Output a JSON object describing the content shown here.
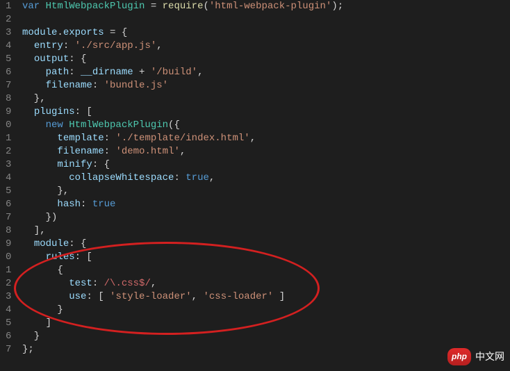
{
  "lines": [
    {
      "n": "1",
      "tokens": [
        {
          "t": "var ",
          "c": "kw"
        },
        {
          "t": "HtmlWebpackPlugin",
          "c": "cls"
        },
        {
          "t": " = ",
          "c": "punc"
        },
        {
          "t": "require",
          "c": "fn"
        },
        {
          "t": "(",
          "c": "punc"
        },
        {
          "t": "'html-webpack-plugin'",
          "c": "str"
        },
        {
          "t": ");",
          "c": "punc"
        }
      ]
    },
    {
      "n": "2",
      "tokens": []
    },
    {
      "n": "3",
      "tokens": [
        {
          "t": "module",
          "c": "var"
        },
        {
          "t": ".",
          "c": "punc"
        },
        {
          "t": "exports",
          "c": "var"
        },
        {
          "t": " = {",
          "c": "punc"
        }
      ]
    },
    {
      "n": "4",
      "tokens": [
        {
          "t": "  ",
          "c": "punc"
        },
        {
          "t": "entry",
          "c": "prop"
        },
        {
          "t": ": ",
          "c": "punc"
        },
        {
          "t": "'./src/app.js'",
          "c": "str"
        },
        {
          "t": ",",
          "c": "punc"
        }
      ]
    },
    {
      "n": "5",
      "tokens": [
        {
          "t": "  ",
          "c": "punc"
        },
        {
          "t": "output",
          "c": "prop"
        },
        {
          "t": ": {",
          "c": "punc"
        }
      ]
    },
    {
      "n": "6",
      "tokens": [
        {
          "t": "    ",
          "c": "punc"
        },
        {
          "t": "path",
          "c": "prop"
        },
        {
          "t": ": ",
          "c": "punc"
        },
        {
          "t": "__dirname",
          "c": "var"
        },
        {
          "t": " + ",
          "c": "punc"
        },
        {
          "t": "'/build'",
          "c": "str"
        },
        {
          "t": ",",
          "c": "punc"
        }
      ]
    },
    {
      "n": "7",
      "tokens": [
        {
          "t": "    ",
          "c": "punc"
        },
        {
          "t": "filename",
          "c": "prop"
        },
        {
          "t": ": ",
          "c": "punc"
        },
        {
          "t": "'bundle.js'",
          "c": "str"
        }
      ]
    },
    {
      "n": "8",
      "tokens": [
        {
          "t": "  },",
          "c": "punc"
        }
      ]
    },
    {
      "n": "9",
      "tokens": [
        {
          "t": "  ",
          "c": "punc"
        },
        {
          "t": "plugins",
          "c": "prop"
        },
        {
          "t": ": [",
          "c": "punc"
        }
      ]
    },
    {
      "n": "0",
      "tokens": [
        {
          "t": "    ",
          "c": "punc"
        },
        {
          "t": "new ",
          "c": "kw"
        },
        {
          "t": "HtmlWebpackPlugin",
          "c": "cls"
        },
        {
          "t": "({",
          "c": "punc"
        }
      ]
    },
    {
      "n": "1",
      "tokens": [
        {
          "t": "      ",
          "c": "punc"
        },
        {
          "t": "template",
          "c": "prop"
        },
        {
          "t": ": ",
          "c": "punc"
        },
        {
          "t": "'./template/index.html'",
          "c": "str"
        },
        {
          "t": ",",
          "c": "punc"
        }
      ]
    },
    {
      "n": "2",
      "tokens": [
        {
          "t": "      ",
          "c": "punc"
        },
        {
          "t": "filename",
          "c": "prop"
        },
        {
          "t": ": ",
          "c": "punc"
        },
        {
          "t": "'demo.html'",
          "c": "str"
        },
        {
          "t": ",",
          "c": "punc"
        }
      ]
    },
    {
      "n": "3",
      "tokens": [
        {
          "t": "      ",
          "c": "punc"
        },
        {
          "t": "minify",
          "c": "prop"
        },
        {
          "t": ": {",
          "c": "punc"
        }
      ]
    },
    {
      "n": "4",
      "tokens": [
        {
          "t": "        ",
          "c": "punc"
        },
        {
          "t": "collapseWhitespace",
          "c": "prop"
        },
        {
          "t": ": ",
          "c": "punc"
        },
        {
          "t": "true",
          "c": "bool"
        },
        {
          "t": ",",
          "c": "punc"
        }
      ]
    },
    {
      "n": "5",
      "tokens": [
        {
          "t": "      },",
          "c": "punc"
        }
      ]
    },
    {
      "n": "6",
      "tokens": [
        {
          "t": "      ",
          "c": "punc"
        },
        {
          "t": "hash",
          "c": "prop"
        },
        {
          "t": ": ",
          "c": "punc"
        },
        {
          "t": "true",
          "c": "bool"
        }
      ]
    },
    {
      "n": "7",
      "tokens": [
        {
          "t": "    })",
          "c": "punc"
        }
      ]
    },
    {
      "n": "8",
      "tokens": [
        {
          "t": "  ],",
          "c": "punc"
        }
      ]
    },
    {
      "n": "9",
      "tokens": [
        {
          "t": "  ",
          "c": "punc"
        },
        {
          "t": "module",
          "c": "prop"
        },
        {
          "t": ": {",
          "c": "punc"
        }
      ]
    },
    {
      "n": "0",
      "tokens": [
        {
          "t": "    ",
          "c": "punc"
        },
        {
          "t": "rules",
          "c": "prop"
        },
        {
          "t": ": [",
          "c": "punc"
        }
      ]
    },
    {
      "n": "1",
      "tokens": [
        {
          "t": "      {",
          "c": "punc"
        }
      ]
    },
    {
      "n": "2",
      "tokens": [
        {
          "t": "        ",
          "c": "punc"
        },
        {
          "t": "test",
          "c": "prop"
        },
        {
          "t": ": ",
          "c": "punc"
        },
        {
          "t": "/\\.css$/",
          "c": "regex"
        },
        {
          "t": ",",
          "c": "punc"
        }
      ]
    },
    {
      "n": "3",
      "tokens": [
        {
          "t": "        ",
          "c": "punc"
        },
        {
          "t": "use",
          "c": "prop"
        },
        {
          "t": ": [ ",
          "c": "punc"
        },
        {
          "t": "'style-loader'",
          "c": "str"
        },
        {
          "t": ", ",
          "c": "punc"
        },
        {
          "t": "'css-loader'",
          "c": "str"
        },
        {
          "t": " ]",
          "c": "punc"
        }
      ]
    },
    {
      "n": "4",
      "tokens": [
        {
          "t": "      }",
          "c": "punc"
        }
      ]
    },
    {
      "n": "5",
      "tokens": [
        {
          "t": "    ]",
          "c": "punc"
        }
      ]
    },
    {
      "n": "6",
      "tokens": [
        {
          "t": "  }",
          "c": "punc"
        }
      ]
    },
    {
      "n": "7",
      "tokens": [
        {
          "t": "};",
          "c": "punc"
        }
      ]
    }
  ],
  "watermark": {
    "badge": "php",
    "text": "中文网"
  }
}
